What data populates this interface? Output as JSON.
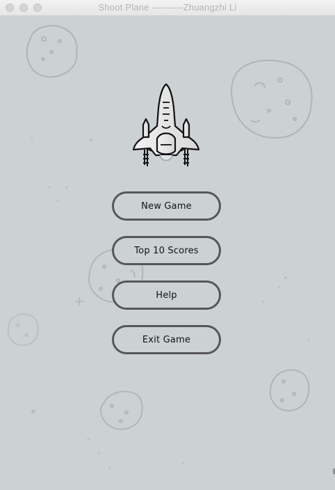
{
  "window": {
    "title": "Shoot Plane ----------Zhuangzhi Li"
  },
  "menu": {
    "new_game": "New Game",
    "top_scores": "Top 10 Scores",
    "help": "Help",
    "exit_game": "Exit Game"
  },
  "icons": {
    "plane": "fighter-jet-icon",
    "asteroids": "asteroid-icon"
  },
  "colors": {
    "background": "#ccd2d4",
    "button_border": "#575757",
    "title_text": "#b3b3b3"
  }
}
